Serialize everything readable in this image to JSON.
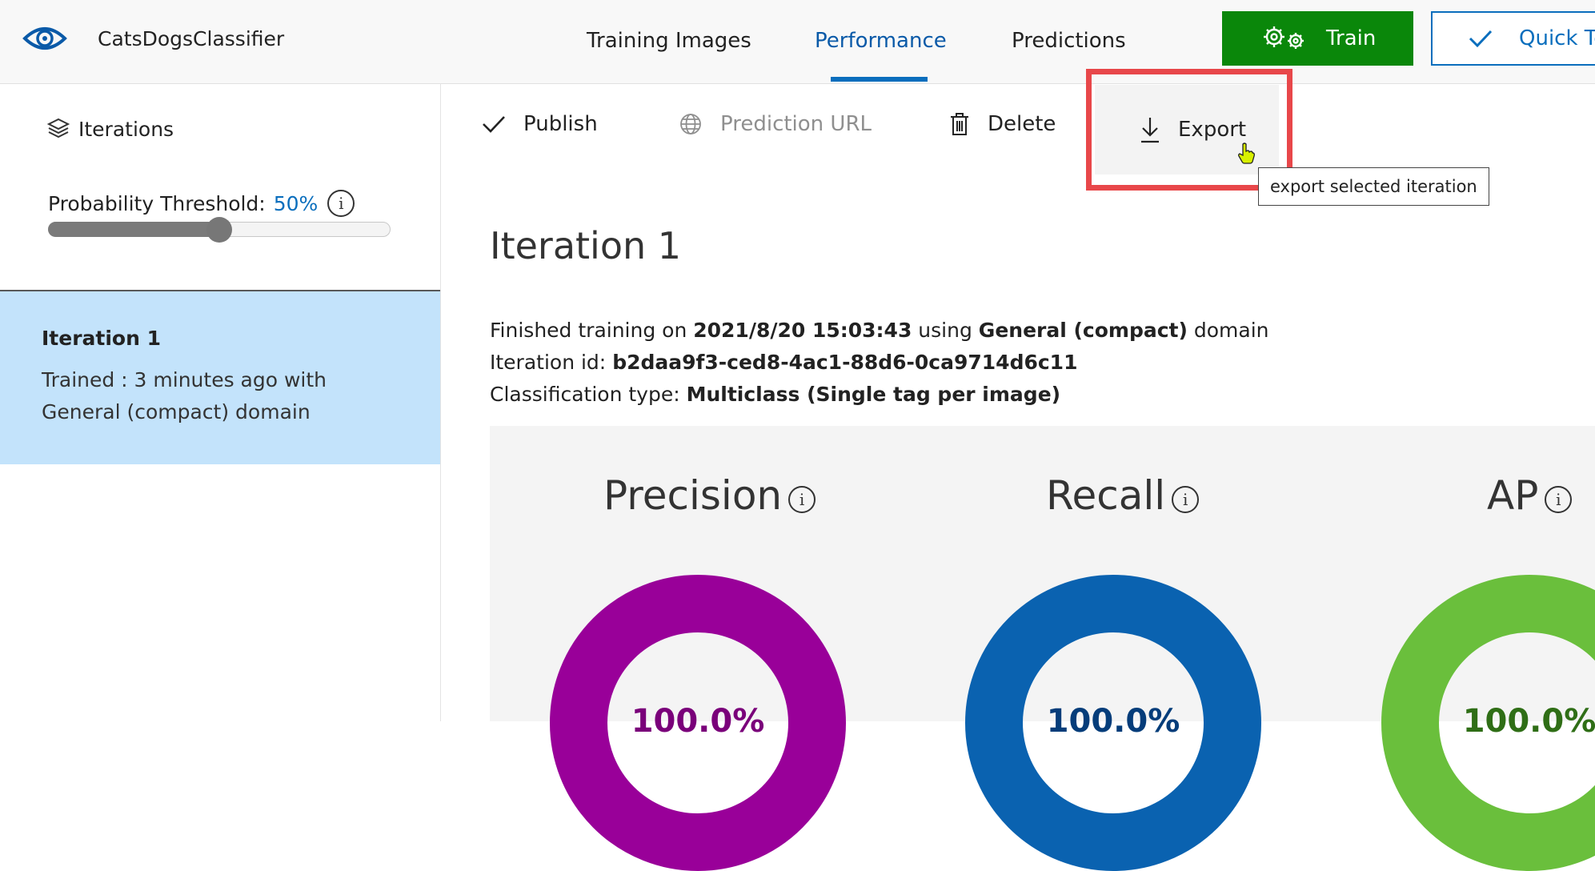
{
  "app": {
    "name": "CatsDogsClassifier"
  },
  "nav": {
    "tabs": [
      {
        "label": "Training Images"
      },
      {
        "label": "Performance",
        "active": true
      },
      {
        "label": "Predictions"
      }
    ]
  },
  "header_actions": {
    "train_label": "Train",
    "quick_test_label": "Quick Test"
  },
  "sidebar": {
    "heading": "Iterations",
    "threshold_label": "Probability Threshold:",
    "threshold_value": "50%",
    "threshold_fraction": 0.5,
    "iterations": [
      {
        "title": "Iteration 1",
        "line1": "Trained : 3 minutes ago with",
        "line2": "General (compact) domain",
        "selected": true
      }
    ]
  },
  "toolbar": {
    "publish_label": "Publish",
    "prediction_url_label": "Prediction URL",
    "delete_label": "Delete",
    "export_label": "Export",
    "export_tooltip": "export selected iteration"
  },
  "iteration": {
    "title": "Iteration 1",
    "trained_prefix": "Finished training on ",
    "trained_date": "2021/8/20 15:03:43",
    "trained_mid": " using ",
    "trained_domain": "General (compact)",
    "trained_suffix": " domain",
    "id_prefix": "Iteration id: ",
    "id_value": "b2daa9f3-ced8-4ac1-88d6-0ca9714d6c11",
    "type_prefix": "Classification type: ",
    "type_value": "Multiclass (Single tag per image)"
  },
  "metrics": [
    {
      "name": "Precision",
      "value": "100.0%",
      "fraction": 1.0,
      "color": "#990099"
    },
    {
      "name": "Recall",
      "value": "100.0%",
      "fraction": 1.0,
      "color": "#0a62b0"
    },
    {
      "name": "AP",
      "value": "100.0%",
      "fraction": 1.0,
      "color": "#6abf3c"
    }
  ],
  "colors": {
    "accent": "#0a6ebd",
    "train_button": "#0a870a",
    "highlight": "#e8474a",
    "selected_item": "#c3e3fb"
  }
}
